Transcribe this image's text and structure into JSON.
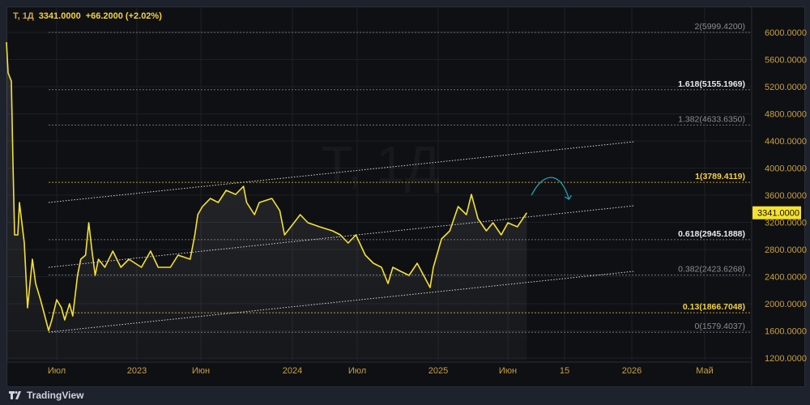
{
  "legend": {
    "symbol": "Т, 1Д",
    "price": "3341.0000",
    "change": "+66.2000 (+2.02%)"
  },
  "watermark": "Т, 1Д",
  "footer": {
    "brand": "TradingView"
  },
  "colors": {
    "price_line": "#f5e12f",
    "fib_yellow": "#f5d33a",
    "fib_white": "#e8e8e8",
    "fib_gray": "#8a8d94",
    "axis_text": "#c9a13c",
    "arrow": "#20a4b4",
    "last_price_bg": "#f5e12f"
  },
  "chart_data": {
    "type": "line",
    "title": "Т, 1Д",
    "ylim": [
      1200,
      6000
    ],
    "y_ticks": [
      "1200.0000",
      "1600.0000",
      "2000.0000",
      "2400.0000",
      "2800.0000",
      "3200.0000",
      "3600.0000",
      "4000.0000",
      "4400.0000",
      "4800.0000",
      "5200.0000",
      "5600.0000",
      "6000.0000"
    ],
    "x_ticks": [
      {
        "label": "Июл",
        "t": 2022.5
      },
      {
        "label": "2023",
        "t": 2023.0
      },
      {
        "label": "Июн",
        "t": 2023.42
      },
      {
        "label": "2024",
        "t": 2024.0
      },
      {
        "label": "Июл",
        "t": 2024.5
      },
      {
        "label": "2025",
        "t": 2025.0
      },
      {
        "label": "Июн",
        "t": 2025.42
      },
      {
        "label": "15",
        "t": 2025.54
      },
      {
        "label": "2026",
        "t": 2026.0
      },
      {
        "label": "Май",
        "t": 2026.33
      }
    ],
    "last_price": {
      "value": 3341,
      "label": "3341.0000"
    },
    "series": [
      {
        "name": "Т",
        "points": [
          [
            2022.19,
            5857
          ],
          [
            2022.2,
            5403
          ],
          [
            2022.22,
            5284
          ],
          [
            2022.23,
            4090
          ],
          [
            2022.24,
            3015
          ],
          [
            2022.26,
            3015
          ],
          [
            2022.27,
            3493
          ],
          [
            2022.3,
            2896
          ],
          [
            2022.32,
            1940
          ],
          [
            2022.35,
            2657
          ],
          [
            2022.37,
            2299
          ],
          [
            2022.4,
            2060
          ],
          [
            2022.42,
            1881
          ],
          [
            2022.45,
            1606
          ],
          [
            2022.47,
            1761
          ],
          [
            2022.5,
            2060
          ],
          [
            2022.53,
            1940
          ],
          [
            2022.55,
            1761
          ],
          [
            2022.58,
            2000
          ],
          [
            2022.6,
            1820
          ],
          [
            2022.63,
            2418
          ],
          [
            2022.65,
            2657
          ],
          [
            2022.68,
            2716
          ],
          [
            2022.7,
            3194
          ],
          [
            2022.72,
            2776
          ],
          [
            2022.74,
            2418
          ],
          [
            2022.76,
            2657
          ],
          [
            2022.8,
            2537
          ],
          [
            2022.85,
            2776
          ],
          [
            2022.9,
            2537
          ],
          [
            2022.95,
            2657
          ],
          [
            2023.03,
            2537
          ],
          [
            2023.09,
            2776
          ],
          [
            2023.14,
            2537
          ],
          [
            2023.22,
            2537
          ],
          [
            2023.27,
            2716
          ],
          [
            2023.35,
            2657
          ],
          [
            2023.38,
            3015
          ],
          [
            2023.4,
            3313
          ],
          [
            2023.43,
            3433
          ],
          [
            2023.48,
            3552
          ],
          [
            2023.53,
            3493
          ],
          [
            2023.58,
            3672
          ],
          [
            2023.64,
            3612
          ],
          [
            2023.69,
            3731
          ],
          [
            2023.71,
            3493
          ],
          [
            2023.76,
            3313
          ],
          [
            2023.79,
            3493
          ],
          [
            2023.87,
            3552
          ],
          [
            2023.92,
            3373
          ],
          [
            2023.95,
            3015
          ],
          [
            2023.99,
            3134
          ],
          [
            2024.06,
            3313
          ],
          [
            2024.12,
            3194
          ],
          [
            2024.21,
            3134
          ],
          [
            2024.31,
            3075
          ],
          [
            2024.37,
            3015
          ],
          [
            2024.43,
            2896
          ],
          [
            2024.49,
            3015
          ],
          [
            2024.55,
            2716
          ],
          [
            2024.6,
            2597
          ],
          [
            2024.65,
            2537
          ],
          [
            2024.69,
            2299
          ],
          [
            2024.72,
            2537
          ],
          [
            2024.77,
            2477
          ],
          [
            2024.82,
            2418
          ],
          [
            2024.87,
            2597
          ],
          [
            2024.91,
            2418
          ],
          [
            2024.95,
            2239
          ],
          [
            2024.97,
            2537
          ],
          [
            2025.02,
            2955
          ],
          [
            2025.07,
            3075
          ],
          [
            2025.12,
            3433
          ],
          [
            2025.17,
            3313
          ],
          [
            2025.2,
            3612
          ],
          [
            2025.24,
            3254
          ],
          [
            2025.29,
            3075
          ],
          [
            2025.33,
            3194
          ],
          [
            2025.38,
            3015
          ],
          [
            2025.42,
            3194
          ],
          [
            2025.44,
            3134
          ],
          [
            2025.46,
            3341
          ]
        ]
      }
    ],
    "channel": [
      {
        "name": "upper",
        "from": [
          2022.45,
          3493
        ],
        "to": [
          2026.01,
          4388
        ]
      },
      {
        "name": "middle",
        "from": [
          2022.45,
          2537
        ],
        "to": [
          2026.01,
          3444
        ]
      },
      {
        "name": "lower",
        "from": [
          2022.45,
          1582
        ],
        "to": [
          2026.01,
          2478
        ]
      }
    ],
    "fib_levels": [
      {
        "label": "2(5999.4200)",
        "value": 5999.42,
        "style": "gray"
      },
      {
        "label": "1.618(5155.1969)",
        "value": 5155.1969,
        "style": "white"
      },
      {
        "label": "1.382(4633.6350)",
        "value": 4633.635,
        "style": "gray"
      },
      {
        "label": "1(3789.4119)",
        "value": 3789.4119,
        "style": "yellow"
      },
      {
        "label": "0.618(2945.1888)",
        "value": 2945.1888,
        "style": "white"
      },
      {
        "label": "0.382(2423.6268)",
        "value": 2423.6268,
        "style": "gray"
      },
      {
        "label": "0.13(1866.7048)",
        "value": 1866.7048,
        "style": "yellow"
      },
      {
        "label": "0(1579.4037)",
        "value": 1579.4037,
        "style": "gray"
      }
    ],
    "forecast_arrow": {
      "from": [
        2025.47,
        3600
      ],
      "to": [
        2025.57,
        3540
      ]
    }
  }
}
